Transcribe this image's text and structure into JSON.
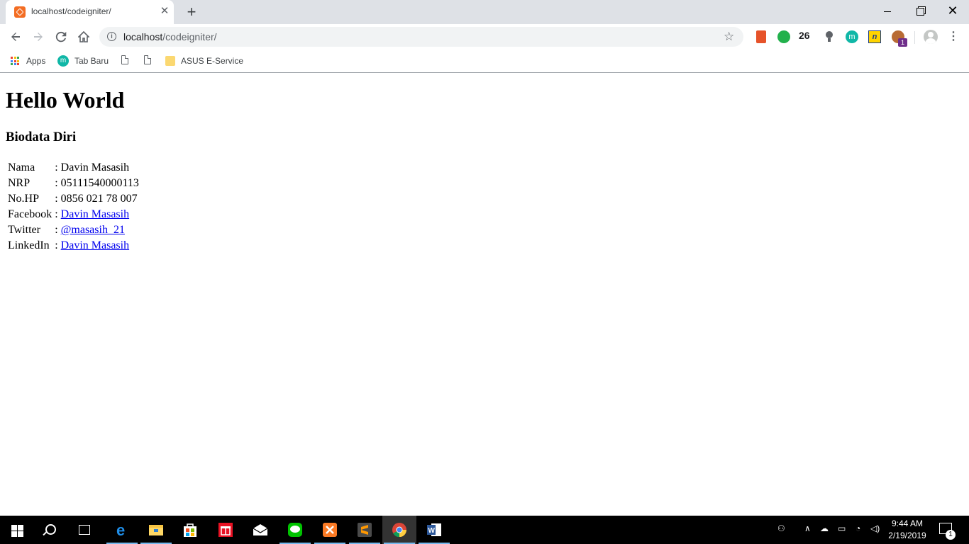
{
  "browser": {
    "tab_title": "localhost/codeigniter/",
    "url_host": "localhost",
    "url_path": "/codeigniter/",
    "extension_count": "26",
    "extension_badge": "1",
    "ext_m_letter": "m",
    "ext_n_letter": "n"
  },
  "bookmarks": {
    "apps": "Apps",
    "tab_baru": "Tab Baru",
    "tab_baru_letter": "m",
    "asus": "ASUS E-Service"
  },
  "page": {
    "heading": "Hello World",
    "subheading": "Biodata Diri",
    "rows": [
      {
        "label": "Nama",
        "sep": ":",
        "value": "Davin Masasih"
      },
      {
        "label": "NRP",
        "sep": ":",
        "value": "05111540000113"
      },
      {
        "label": "No.HP",
        "sep": ":",
        "value": "0856 021 78 007"
      },
      {
        "label": "Facebook",
        "sep": ":",
        "value": "Davin Masasih"
      },
      {
        "label": "Twitter",
        "sep": ":",
        "value": "@masasih_21"
      },
      {
        "label": "LinkedIn",
        "sep": ":",
        "value": "Davin Masasih"
      }
    ]
  },
  "taskbar": {
    "time": "9:44 AM",
    "date": "2/19/2019",
    "notification_count": "1"
  },
  "colors": {
    "link": "#0000ee",
    "tab_strip": "#dee1e6",
    "taskbar": "#000000",
    "taskbar_active": "#76b9ed"
  }
}
